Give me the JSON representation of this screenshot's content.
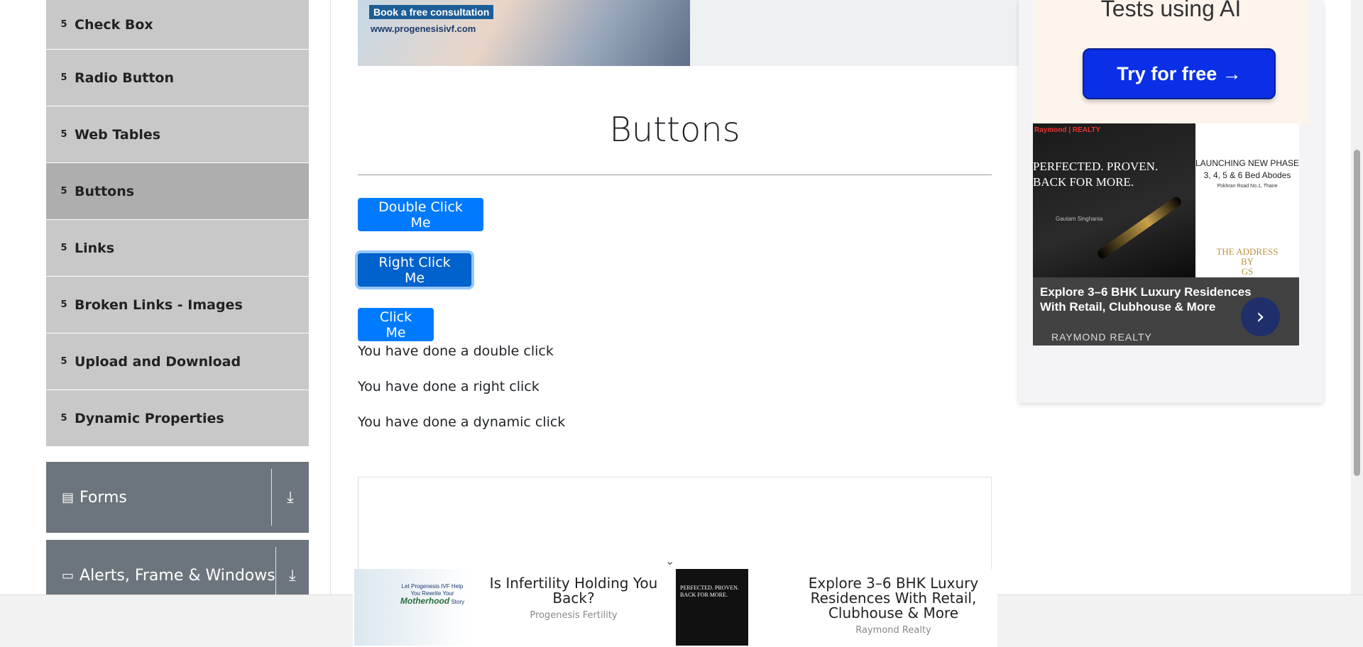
{
  "sidebar": {
    "items": [
      {
        "label": "Check Box",
        "icon": "html5-icon"
      },
      {
        "label": "Radio Button",
        "icon": "html5-icon"
      },
      {
        "label": "Web Tables",
        "icon": "html5-icon"
      },
      {
        "label": "Buttons",
        "icon": "html5-icon",
        "active": true
      },
      {
        "label": "Links",
        "icon": "html5-icon"
      },
      {
        "label": "Broken Links - Images",
        "icon": "html5-icon"
      },
      {
        "label": "Upload and Download",
        "icon": "html5-icon"
      },
      {
        "label": "Dynamic Properties",
        "icon": "html5-icon"
      }
    ],
    "groups": [
      {
        "label": "Forms",
        "icon": "form-icon",
        "toggle_icon": "download-arrow-icon"
      },
      {
        "label": "Alerts, Frame & Windows",
        "icon": "window-icon",
        "toggle_icon": "download-arrow-icon"
      }
    ]
  },
  "top_banner": {
    "cta": "Book a free consultation",
    "url": "www.progenesisivf.com"
  },
  "main": {
    "title": "Buttons",
    "buttons": {
      "double_click": "Double Click Me",
      "right_click": "Right Click Me",
      "click": "Click Me"
    },
    "messages": {
      "double": "You have done a double click",
      "right": "You have done a right click",
      "dynamic": "You have done a dynamic click"
    }
  },
  "right_ad": {
    "heading": "Tests using AI",
    "try_button": "Try for free →",
    "brand": "Raymond | REALTY",
    "tagline": "PERFECTED. PROVEN.\nBACK FOR MORE.",
    "signature": "Gautam Singhania",
    "launch": "LAUNCHING NEW PHASE\n3, 4, 5 & 6 Bed Abodes",
    "road": "Pokhran Road No.1, Thane",
    "address": "THE ADDRESS\nBY\nGS",
    "headline": "Explore 3–6 BHK Luxury Residences With Retail, Clubhouse & More",
    "company": "RAYMOND REALTY"
  },
  "bottom_ad": {
    "cards": [
      {
        "title": "Is Infertility Holding You Back?",
        "source": "Progenesis Fertility",
        "thumb_text": "Let Progenesis IVF Help You Rewrite Your",
        "thumb_emph": "Motherhood",
        "thumb_tail": "Story"
      },
      {
        "title": "Explore 3–6 BHK Luxury Residences With Retail, Clubhouse & More",
        "source": "Raymond Realty",
        "thumb_text": "PERFECTED. PROVEN.\nBACK FOR MORE."
      }
    ],
    "chevron": "⌄"
  },
  "colors": {
    "primary": "#007bff",
    "sidebar_item": "#c8c8c8",
    "sidebar_active": "#aeaeae",
    "group_header": "#6c757d"
  }
}
